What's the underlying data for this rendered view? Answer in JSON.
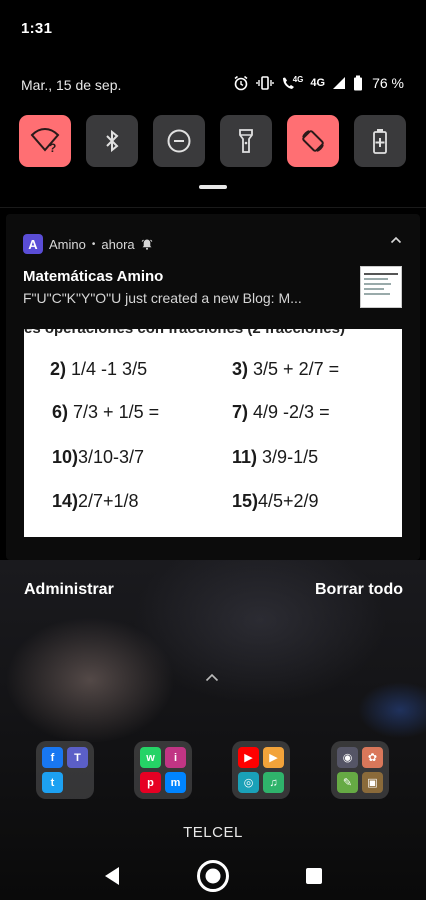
{
  "status": {
    "time": "1:31",
    "date": "Mar., 15 de sep.",
    "battery": "76 %",
    "network": "4G",
    "call_network": "4G"
  },
  "quick_settings": [
    {
      "name": "wifi",
      "icon": "wifi-question-icon",
      "on": true
    },
    {
      "name": "bluetooth",
      "icon": "bluetooth-icon",
      "on": false
    },
    {
      "name": "dnd",
      "icon": "do-not-disturb-icon",
      "on": false
    },
    {
      "name": "flashlight",
      "icon": "flashlight-icon",
      "on": false
    },
    {
      "name": "auto-rotate",
      "icon": "auto-rotate-icon",
      "on": true
    },
    {
      "name": "battery-saver",
      "icon": "battery-saver-icon",
      "on": false
    }
  ],
  "notification": {
    "app": "Amino",
    "separator": "•",
    "when": "ahora",
    "title": "Matemáticas Amino",
    "text": "F\"U\"C\"K\"Y\"O\"U just created a new Blog: M...",
    "image_header": "es operaciones con fracciones (2 fracciones)",
    "problems": [
      {
        "num": "2)",
        "expr": "1/4 -1 3/5"
      },
      {
        "num": "3)",
        "expr": "3/5 + 2/7 ="
      },
      {
        "num": "6)",
        "expr": "7/3 + 1/5 ="
      },
      {
        "num": "7)",
        "expr": "4/9 -2/3 ="
      },
      {
        "num": "10)",
        "expr": "3/10-3/7"
      },
      {
        "num": "11)",
        "expr": "3/9-1/5"
      },
      {
        "num": "14)",
        "expr": "2/7+1/8"
      },
      {
        "num": "15)",
        "expr": "4/5+2/9"
      }
    ]
  },
  "actions": {
    "manage": "Administrar",
    "clear_all": "Borrar todo"
  },
  "carrier": "TELCEL",
  "colors": {
    "tile_on": "#ff6f73",
    "tile_off": "#3a3a3c",
    "amino": "#5a4dd6"
  }
}
